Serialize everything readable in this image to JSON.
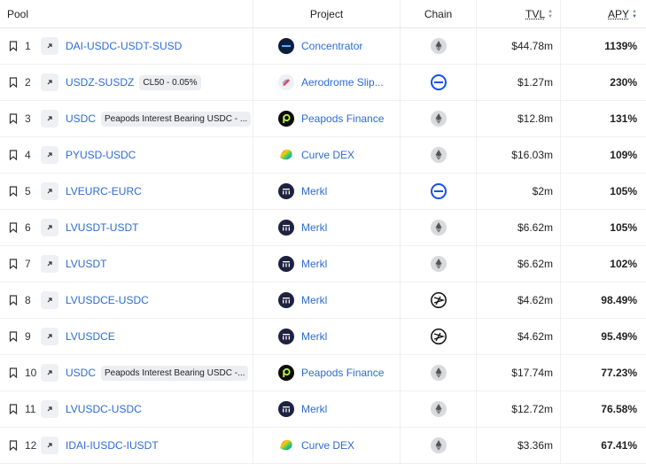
{
  "header": {
    "pool": "Pool",
    "project": "Project",
    "chain": "Chain",
    "tvl": "TVL",
    "apy": "APY"
  },
  "rows": [
    {
      "rank": "1",
      "pool": "DAI-USDC-USDT-SUSD",
      "badge": "",
      "project": "Concentrator",
      "project_icon": "concentrator-icon",
      "chain": "ethereum-icon",
      "tvl": "$44.78m",
      "apy": "1139%"
    },
    {
      "rank": "2",
      "pool": "USDZ-SUSDZ",
      "badge": "CL50 - 0.05%",
      "project": "Aerodrome Slip...",
      "project_icon": "aerodrome-icon",
      "chain": "base-icon",
      "tvl": "$1.27m",
      "apy": "230%"
    },
    {
      "rank": "3",
      "pool": "USDC",
      "badge": "Peapods Interest Bearing USDC - ...",
      "project": "Peapods Finance",
      "project_icon": "peapods-icon",
      "chain": "ethereum-icon",
      "tvl": "$12.8m",
      "apy": "131%"
    },
    {
      "rank": "4",
      "pool": "PYUSD-USDC",
      "badge": "",
      "project": "Curve DEX",
      "project_icon": "curve-icon",
      "chain": "ethereum-icon",
      "tvl": "$16.03m",
      "apy": "109%"
    },
    {
      "rank": "5",
      "pool": "LVEURC-EURC",
      "badge": "",
      "project": "Merkl",
      "project_icon": "merkl-icon",
      "chain": "base-icon",
      "tvl": "$2m",
      "apy": "105%"
    },
    {
      "rank": "6",
      "pool": "LVUSDT-USDT",
      "badge": "",
      "project": "Merkl",
      "project_icon": "merkl-icon",
      "chain": "ethereum-icon",
      "tvl": "$6.62m",
      "apy": "105%"
    },
    {
      "rank": "7",
      "pool": "LVUSDT",
      "badge": "",
      "project": "Merkl",
      "project_icon": "merkl-icon",
      "chain": "ethereum-icon",
      "tvl": "$6.62m",
      "apy": "102%"
    },
    {
      "rank": "8",
      "pool": "LVUSDCE-USDC",
      "badge": "",
      "project": "Merkl",
      "project_icon": "merkl-icon",
      "chain": "arbitrum-icon",
      "tvl": "$4.62m",
      "apy": "98.49%"
    },
    {
      "rank": "9",
      "pool": "LVUSDCE",
      "badge": "",
      "project": "Merkl",
      "project_icon": "merkl-icon",
      "chain": "arbitrum-icon",
      "tvl": "$4.62m",
      "apy": "95.49%"
    },
    {
      "rank": "10",
      "pool": "USDC",
      "badge": "Peapods Interest Bearing USDC -...",
      "project": "Peapods Finance",
      "project_icon": "peapods-icon",
      "chain": "ethereum-icon",
      "tvl": "$17.74m",
      "apy": "77.23%"
    },
    {
      "rank": "11",
      "pool": "LVUSDC-USDC",
      "badge": "",
      "project": "Merkl",
      "project_icon": "merkl-icon",
      "chain": "ethereum-icon",
      "tvl": "$12.72m",
      "apy": "76.58%"
    },
    {
      "rank": "12",
      "pool": "IDAI-IUSDC-IUSDT",
      "badge": "",
      "project": "Curve DEX",
      "project_icon": "curve-icon",
      "chain": "ethereum-icon",
      "tvl": "$3.36m",
      "apy": "67.41%"
    }
  ],
  "colors": {
    "link": "#2d6bd6",
    "base": "#1652f0",
    "merkl": "#1f2140",
    "peapods": "#0d0d0d",
    "concentrator": "#0b1e3b"
  }
}
